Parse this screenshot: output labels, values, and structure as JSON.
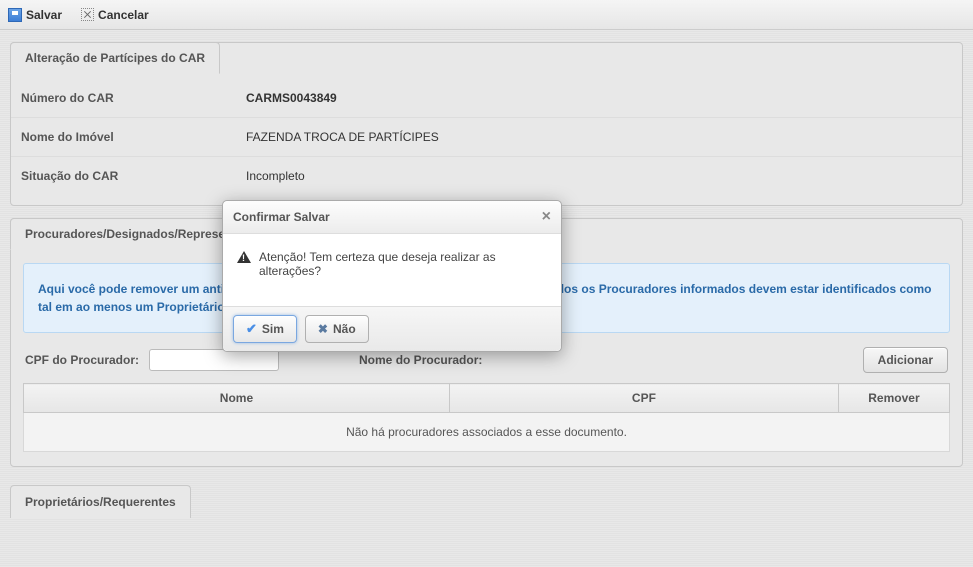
{
  "toolbar": {
    "save_label": "Salvar",
    "cancel_label": "Cancelar"
  },
  "main_panel": {
    "title": "Alteração de Partícipes do CAR",
    "rows": {
      "numero_label": "Número do CAR",
      "numero_value": "CARMS0043849",
      "nome_label": "Nome do Imóvel",
      "nome_value": "FAZENDA TROCA DE PARTÍCIPES",
      "situacao_label": "Situação do CAR",
      "situacao_value": "Incompleto"
    }
  },
  "procuradores_panel": {
    "title": "Procuradores/Designados/Representantes",
    "alert_text": "Aqui você pode remover um antigo ou adicionar um novo Procurador do CAR. Atenção! Todos os Procuradores informados devem estar identificados como tal em ao menos um Proprietário do CAR.",
    "cpf_label": "CPF do Procurador:",
    "cpf_value": "",
    "nome_proc_label": "Nome do Procurador:",
    "add_button": "Adicionar",
    "table": {
      "col_nome": "Nome",
      "col_cpf": "CPF",
      "col_remover": "Remover",
      "empty_text": "Não há procuradores associados a esse documento."
    }
  },
  "proprietarios_panel": {
    "title": "Proprietários/Requerentes"
  },
  "modal": {
    "title": "Confirmar Salvar",
    "message": "Atenção! Tem certeza que deseja realizar as alterações?",
    "yes_label": "Sim",
    "no_label": "Não"
  }
}
